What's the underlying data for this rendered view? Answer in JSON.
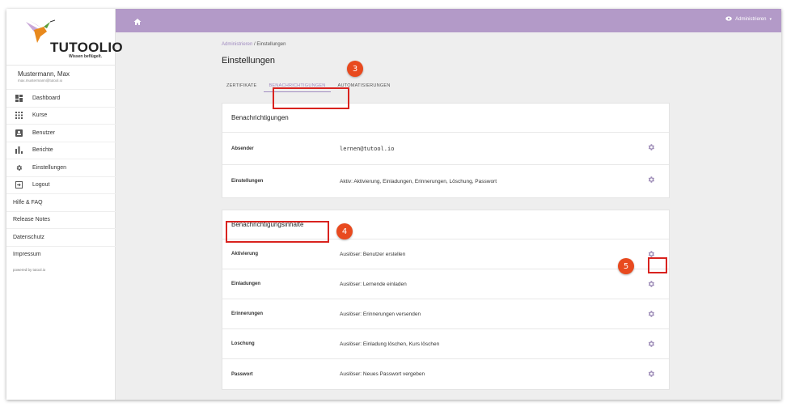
{
  "brand": {
    "name": "TUTOOLIO",
    "tagline": "Wissen beflügelt.",
    "accent": "#b39ac8"
  },
  "user": {
    "name": "Mustermann, Max",
    "email": "max.mustermann@tutool.io"
  },
  "sidebar": {
    "items": [
      {
        "label": "Dashboard",
        "icon": "dashboard-icon"
      },
      {
        "label": "Kurse",
        "icon": "grid-icon"
      },
      {
        "label": "Benutzer",
        "icon": "user-card-icon"
      },
      {
        "label": "Berichte",
        "icon": "bar-chart-icon"
      },
      {
        "label": "Einstellungen",
        "icon": "gear-icon"
      },
      {
        "label": "Logout",
        "icon": "logout-icon"
      }
    ],
    "links": [
      "Hilfe & FAQ",
      "Release Notes",
      "Datenschutz",
      "Impressum"
    ],
    "powered": "powered by tutool.io"
  },
  "topbar": {
    "admin_label": "Administrieren"
  },
  "breadcrumb": {
    "parent": "Administrieren",
    "separator": "/",
    "current": "Einstellungen"
  },
  "page": {
    "title": "Einstellungen"
  },
  "tabs": [
    "ZERTIFIKATE",
    "BENACHRICHTIGUNGEN",
    "AUTOMATISIERUNGEN"
  ],
  "card1": {
    "title": "Benachrichtigungen",
    "rows": [
      {
        "label": "Absender",
        "value": "lernen@tutool.io"
      },
      {
        "label": "Einstellungen",
        "value": "Aktiv: Aktivierung, Einladungen, Erinnerungen, Löschung, Passwort"
      }
    ]
  },
  "card2": {
    "title": "Benachrichtigungsinhalte",
    "rows": [
      {
        "label": "Aktivierung",
        "value": "Auslöser: Benutzer erstellen"
      },
      {
        "label": "Einladungen",
        "value": "Auslöser: Lernende einladen"
      },
      {
        "label": "Erinnerungen",
        "value": "Auslöser: Erinnerungen versenden"
      },
      {
        "label": "Loschung",
        "value": "Auslöser: Einladung löschen, Kurs löschen"
      },
      {
        "label": "Passwort",
        "value": "Auslöser: Neues Passwort vergeben"
      }
    ]
  },
  "callouts": [
    "3",
    "4",
    "5"
  ]
}
